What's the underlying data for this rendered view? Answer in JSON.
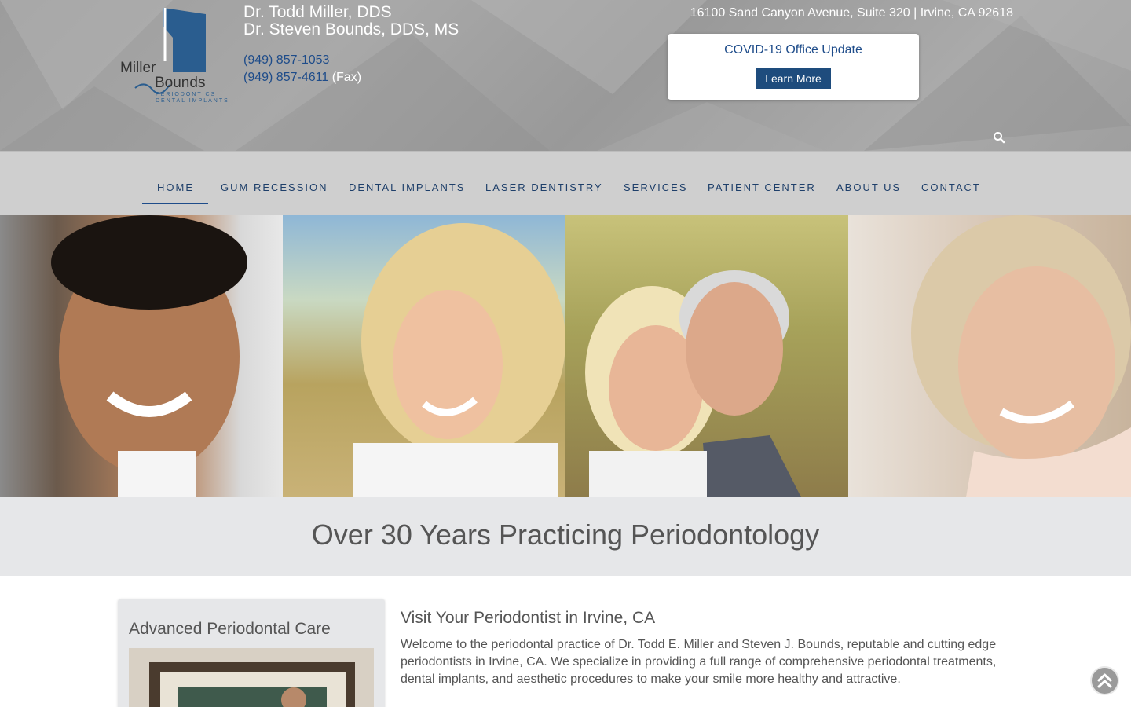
{
  "header": {
    "logo_text": {
      "line1": "Miller",
      "line2": "Bounds",
      "line3": "PERIODONTICS",
      "line4": "DENTAL IMPLANTS"
    },
    "doctors": [
      "Dr. Todd Miller, DDS",
      "Dr. Steven Bounds, DDS, MS"
    ],
    "phone": "(949) 857-1053",
    "fax_number": "(949) 857-4611",
    "fax_label": "(Fax)",
    "address": "16100 Sand Canyon Avenue, Suite 320 | Irvine, CA 92618",
    "covid": {
      "title": "COVID-19 Office Update",
      "button": "Learn More"
    }
  },
  "nav": {
    "items": [
      {
        "label": "HOME"
      },
      {
        "label": "GUM RECESSION"
      },
      {
        "label": "DENTAL IMPLANTS"
      },
      {
        "label": "LASER DENTISTRY"
      },
      {
        "label": "SERVICES"
      },
      {
        "label": "PATIENT CENTER"
      },
      {
        "label": "ABOUT US"
      },
      {
        "label": "CONTACT"
      }
    ],
    "active": "HOME"
  },
  "tagline": "Over 30 Years Practicing Periodontology",
  "sidebar": {
    "title": "Advanced Periodontal Care"
  },
  "main": {
    "title": "Visit Your Periodontist in Irvine, CA",
    "paragraph": "Welcome to the periodontal practice of Dr. Todd E. Miller and Steven J. Bounds, reputable and cutting edge periodontists in Irvine, CA. We specialize in providing a full range of comprehensive periodontal treatments, dental implants, and aesthetic procedures to make your smile more healthy and attractive."
  },
  "colors": {
    "brand_blue": "#1e4c8a",
    "header_gray": "#a3a3a3",
    "nav_gray": "#cfcfcf",
    "band_gray": "#e6e7e9"
  },
  "icons": {
    "search": "search-icon",
    "scroll_top": "double-chevron-up-icon"
  }
}
